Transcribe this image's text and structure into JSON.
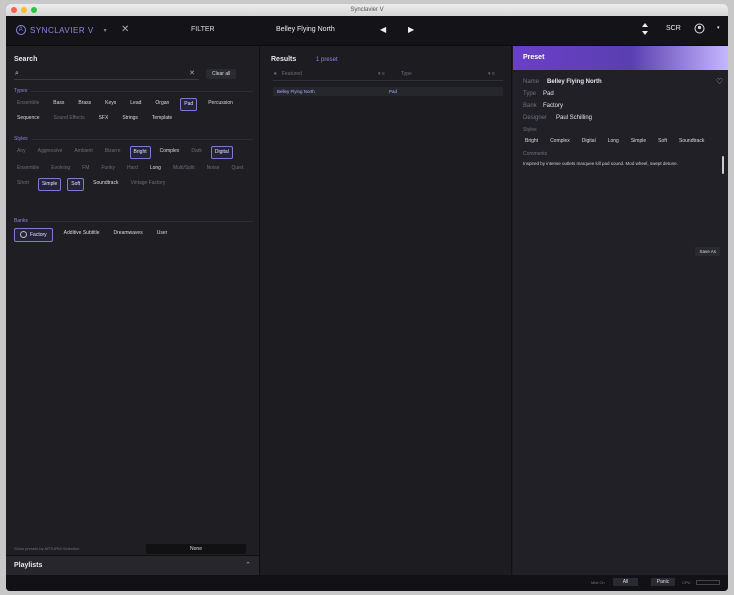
{
  "window": {
    "title": "Synclavier V"
  },
  "topbar": {
    "logo": "SYNCLAVIER V",
    "logo_caret": "▾",
    "close": "✕",
    "filter": "FILTER",
    "preset_name": "Belley Flying North",
    "prev": "◀",
    "next": "▶",
    "scr": "SCR"
  },
  "search": {
    "title": "Search",
    "placeholder": "",
    "clear_x": "✕",
    "clear_all": "Clear all"
  },
  "types": {
    "header": "Types",
    "items": [
      {
        "label": "Ensemble",
        "state": "dim"
      },
      {
        "label": "Bass",
        "state": ""
      },
      {
        "label": "Brass",
        "state": ""
      },
      {
        "label": "Keys",
        "state": ""
      },
      {
        "label": "Lead",
        "state": ""
      },
      {
        "label": "Organ",
        "state": ""
      },
      {
        "label": "Pad",
        "state": "sel"
      },
      {
        "label": "Percussion",
        "state": ""
      },
      {
        "label": "Sequence",
        "state": ""
      },
      {
        "label": "Sound Effects",
        "state": "dim"
      },
      {
        "label": "SFX",
        "state": ""
      },
      {
        "label": "Strings",
        "state": ""
      },
      {
        "label": "Template",
        "state": ""
      }
    ]
  },
  "styles": {
    "header": "Styles",
    "items": [
      {
        "label": "Airy",
        "state": "dim"
      },
      {
        "label": "Aggressive",
        "state": "dim"
      },
      {
        "label": "Ambient",
        "state": "dim"
      },
      {
        "label": "Bizarre",
        "state": "dim"
      },
      {
        "label": "Bright",
        "state": "sel"
      },
      {
        "label": "Complex",
        "state": ""
      },
      {
        "label": "Dark",
        "state": "dim"
      },
      {
        "label": "Digital",
        "state": "sel"
      },
      {
        "label": "Ensemble",
        "state": "dim"
      },
      {
        "label": "Evolving",
        "state": "dim"
      },
      {
        "label": "FM",
        "state": "dim"
      },
      {
        "label": "Funky",
        "state": "dim"
      },
      {
        "label": "Hard",
        "state": "dim"
      },
      {
        "label": "Long",
        "state": ""
      },
      {
        "label": "Multi/Split",
        "state": "dim"
      },
      {
        "label": "Noise",
        "state": "dim"
      },
      {
        "label": "Quiet",
        "state": "dim"
      },
      {
        "label": "Short",
        "state": "dim"
      },
      {
        "label": "Simple",
        "state": "sel"
      },
      {
        "label": "Soft",
        "state": "sel"
      },
      {
        "label": "Soundtrack",
        "state": ""
      },
      {
        "label": "Vintage Factory",
        "state": "dim"
      }
    ]
  },
  "banks": {
    "header": "Banks",
    "items": [
      {
        "label": "Factory",
        "state": "sel"
      },
      {
        "label": "Additive Subtitle",
        "state": ""
      },
      {
        "label": "Dreamwaves",
        "state": ""
      },
      {
        "label": "User",
        "state": ""
      }
    ]
  },
  "left_footer": {
    "caption": "Show presets by ARTURIA Selection",
    "button": "None"
  },
  "playlists": {
    "label": "Playlists",
    "caret": "⌃"
  },
  "results": {
    "title": "Results",
    "count": "1 preset",
    "col_featured": "Featured",
    "col_type": "Type",
    "rows": [
      {
        "name": "Belley Flying North",
        "type": "Pad"
      }
    ]
  },
  "preset": {
    "header": "Preset",
    "name_label": "Name",
    "name": "Belley Flying North",
    "type_label": "Type",
    "type": "Pad",
    "bank_label": "Bank",
    "bank": "Factory",
    "designer_label": "Designer",
    "designer": "Paul Schilling",
    "styles_label": "Styles",
    "style_tags": [
      "Bright",
      "Complex",
      "Digital",
      "Long",
      "Simple",
      "Soft",
      "Soundtrack"
    ],
    "comments_label": "Comments",
    "comments": "Inspired by intense outlets marquee kill pad sound. Mod wheel, swept detune.",
    "save_as": "Save As"
  },
  "statusbar": {
    "label": "Midi Ch",
    "ch": "All",
    "panic": "Panic",
    "cpu": "CPU"
  },
  "colors": {
    "accent": "#8d86e8",
    "header_grad_start": "#7a5fcf",
    "header_grad_end": "#c8b7ff"
  }
}
